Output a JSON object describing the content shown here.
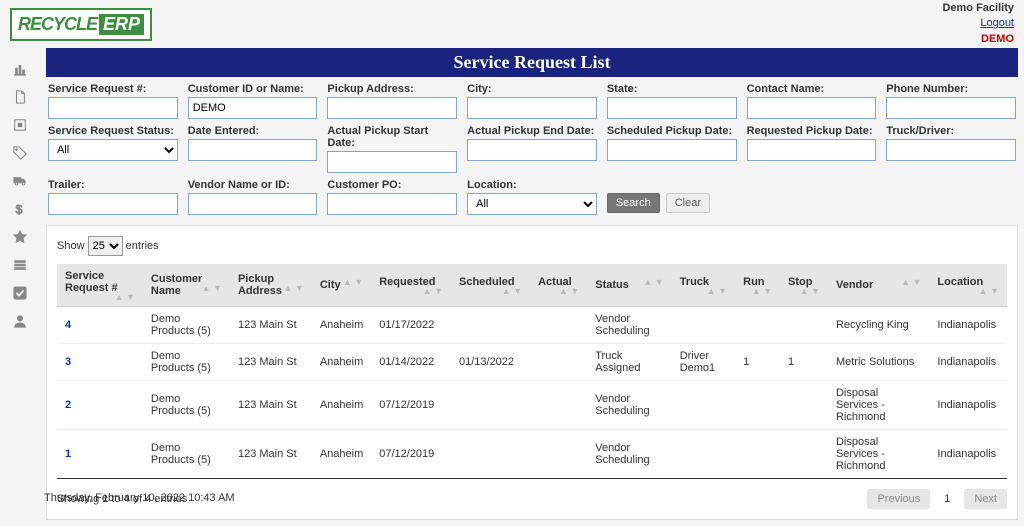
{
  "brand": {
    "part1": "RECYCLE",
    "part2": "ERP"
  },
  "user": {
    "facility": "Demo Facility",
    "logout": "Logout",
    "badge": "DEMO"
  },
  "page_title": "Service Request List",
  "filters": {
    "row1": [
      {
        "label": "Service Request #:",
        "value": ""
      },
      {
        "label": "Customer ID or Name:",
        "value": "DEMO"
      },
      {
        "label": "Pickup Address:",
        "value": ""
      },
      {
        "label": "City:",
        "value": ""
      },
      {
        "label": "State:",
        "value": ""
      },
      {
        "label": "Contact Name:",
        "value": ""
      },
      {
        "label": "Phone Number:",
        "value": ""
      }
    ],
    "row2": [
      {
        "label": "Service Request Status:",
        "type": "select",
        "value": "All"
      },
      {
        "label": "Date Entered:",
        "value": ""
      },
      {
        "label": "Actual Pickup Start Date:",
        "value": ""
      },
      {
        "label": "Actual Pickup End Date:",
        "value": ""
      },
      {
        "label": "Scheduled Pickup Date:",
        "value": ""
      },
      {
        "label": "Requested Pickup Date:",
        "value": ""
      },
      {
        "label": "Truck/Driver:",
        "value": ""
      }
    ],
    "row3": [
      {
        "label": "Trailer:",
        "value": ""
      },
      {
        "label": "Vendor Name or ID:",
        "value": ""
      },
      {
        "label": "Customer PO:",
        "value": ""
      },
      {
        "label": "Location:",
        "type": "select",
        "value": "All"
      }
    ],
    "buttons": {
      "search": "Search",
      "clear": "Clear"
    }
  },
  "table": {
    "show_label_pre": "Show",
    "show_label_post": "entries",
    "show_value": "25",
    "columns": [
      "Service Request #",
      "Customer Name",
      "Pickup Address",
      "City",
      "Requested",
      "Scheduled",
      "Actual",
      "Status",
      "Truck",
      "Run",
      "Stop",
      "Vendor",
      "Location"
    ],
    "rows": [
      {
        "sr": "4",
        "cust": "Demo Products (5)",
        "addr": "123 Main St",
        "city": "Anaheim",
        "req": "01/17/2022",
        "sched": "",
        "actual": "",
        "status": "Vendor Scheduling",
        "truck": "",
        "run": "",
        "stop": "",
        "vendor": "Recycling King",
        "loc": "Indianapolis"
      },
      {
        "sr": "3",
        "cust": "Demo Products (5)",
        "addr": "123 Main St",
        "city": "Anaheim",
        "req": "01/14/2022",
        "sched": "01/13/2022",
        "actual": "",
        "status": "Truck Assigned",
        "truck": "Driver Demo1",
        "run": "1",
        "stop": "1",
        "vendor": "Metric Solutions",
        "loc": "Indianapolis"
      },
      {
        "sr": "2",
        "cust": "Demo Products (5)",
        "addr": "123 Main St",
        "city": "Anaheim",
        "req": "07/12/2019",
        "sched": "",
        "actual": "",
        "status": "Vendor Scheduling",
        "truck": "",
        "run": "",
        "stop": "",
        "vendor": "Disposal Services - Richmond",
        "loc": "Indianapolis"
      },
      {
        "sr": "1",
        "cust": "Demo Products (5)",
        "addr": "123 Main St",
        "city": "Anaheim",
        "req": "07/12/2019",
        "sched": "",
        "actual": "",
        "status": "Vendor Scheduling",
        "truck": "",
        "run": "",
        "stop": "",
        "vendor": "Disposal Services - Richmond",
        "loc": "Indianapolis"
      }
    ],
    "info": "Showing 1 to 4 of 4 entries",
    "pager": {
      "prev": "Previous",
      "page": "1",
      "next": "Next"
    }
  },
  "timestamp": "Thursday, February 10, 2022 10:43 AM"
}
